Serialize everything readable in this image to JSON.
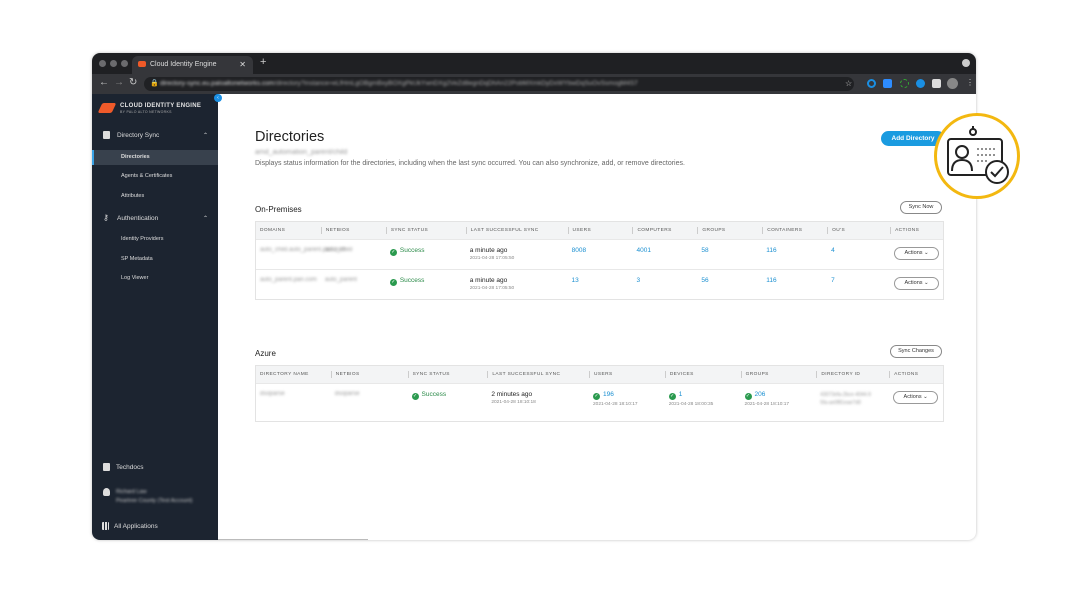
{
  "browser": {
    "tab_title": "Cloud Identity Engine",
    "url_host": "directory-sync.eu.paloaltonetworks.com",
    "url_path": "/directory?instance=eLfHmLgOBgmBxyBOXgPkUkYwnDXg2VeZd8egnDqDhAn22PobMXmkDyDxWYbwDqSuOvSsmogM4S7"
  },
  "sidebar": {
    "logo": "CLOUD IDENTITY ENGINE",
    "logo_sub": "BY PALO ALTO NETWORKS",
    "sections": [
      {
        "label": "Directory Sync",
        "items": [
          "Directories",
          "Agents & Certificates",
          "Attributes"
        ]
      },
      {
        "label": "Authentication",
        "items": [
          "Identity Providers",
          "SP Metadata",
          "Log Viewer"
        ]
      }
    ],
    "techdocs": "Techdocs",
    "user_name": "Richard Law",
    "user_account": "Peartree County (Test Account)",
    "all_apps": "All Applications"
  },
  "page": {
    "title": "Directories",
    "subtitle": "amd_automation_parent/child",
    "description": "Displays status information for the directories, including when the last sync occurred. You can also synchronize, add, or remove directories.",
    "add_button": "Add Directory"
  },
  "onprem": {
    "title": "On-Premises",
    "sync_button": "Sync Now",
    "headers": [
      "DOMAINS",
      "NETBIOS",
      "SYNC STATUS",
      "LAST SUCCESSFUL SYNC",
      "USERS",
      "COMPUTERS",
      "GROUPS",
      "CONTAINERS",
      "OU'S",
      "ACTIONS"
    ],
    "rows": [
      {
        "domain": "auto_child.auto_parent.pan.com",
        "netbios": "auto_child",
        "status": "Success",
        "ago": "a minute ago",
        "time": "2021-04-28 17:05:50",
        "users": "8008",
        "computers": "4001",
        "groups": "58",
        "containers": "116",
        "ous": "4",
        "action": "Actions"
      },
      {
        "domain": "auto_parent.pan.com",
        "netbios": "auto_parent",
        "status": "Success",
        "ago": "a minute ago",
        "time": "2021-04-28 17:05:50",
        "users": "13",
        "computers": "3",
        "groups": "56",
        "containers": "116",
        "ous": "7",
        "action": "Actions"
      }
    ]
  },
  "azure": {
    "title": "Azure",
    "sync_button": "Sync Changes",
    "headers": [
      "DIRECTORY NAME",
      "NETBIOS",
      "SYNC STATUS",
      "LAST SUCCESSFUL SYNC",
      "USERS",
      "DEVICES",
      "GROUPS",
      "DIRECTORY ID",
      "ACTIONS"
    ],
    "rows": [
      {
        "name": "dsoparse",
        "netbios": "dsoparse",
        "status": "Success",
        "ago": "2 minutes ago",
        "time": "2021-04-28 18:10:18",
        "users": "196",
        "users_time": "2021-04-28 18:10:17",
        "devices": "1",
        "devices_time": "2021-04-28 18:00:35",
        "groups": "206",
        "groups_time": "2021-04-28 18:10:17",
        "directory_id": "43073efa-2bce-4044-95fa-ae0f81eae7d0",
        "action": "Actions"
      }
    ]
  },
  "colors": {
    "accent": "#1a9be0",
    "success": "#2a9a4e",
    "sidebar": "#1c2430",
    "badge_ring": "#f3b810"
  }
}
